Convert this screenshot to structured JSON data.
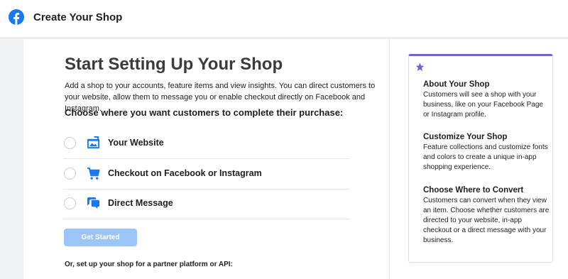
{
  "header": {
    "title": "Create Your Shop",
    "logo_icon": "facebook-logo-icon",
    "brand_color": "#1877f2"
  },
  "main": {
    "heading": "Start Setting Up Your Shop",
    "description": "Add a shop to your accounts, feature items and view insights. You can direct customers to your website, allow them to message you or enable checkout directly on Facebook and Instagram.",
    "choose_label": "Choose where you want customers to complete their purchase:",
    "options": [
      {
        "label": "Your Website",
        "icon": "website-icon",
        "selected": false
      },
      {
        "label": "Checkout on Facebook or Instagram",
        "icon": "cart-icon",
        "selected": false
      },
      {
        "label": "Direct Message",
        "icon": "message-icon",
        "selected": false
      }
    ],
    "get_started_label": "Get Started",
    "get_started_enabled": false,
    "partner_text": "Or, set up your shop for a partner platform or API:"
  },
  "sidebar": {
    "accent_color": "#7b61c9",
    "icon": "star-icon",
    "sections": [
      {
        "title": "About Your Shop",
        "text": "Customers will see a shop with your business, like on your Facebook Page or Instagram profile."
      },
      {
        "title": "Customize Your Shop",
        "text": "Feature collections and customize fonts and colors to create a unique in-app shopping experience."
      },
      {
        "title": "Choose Where to Convert",
        "text": "Customers can convert when they view an item. Choose whether customers are directed to your website, in-app checkout or a direct message with your business."
      }
    ]
  }
}
